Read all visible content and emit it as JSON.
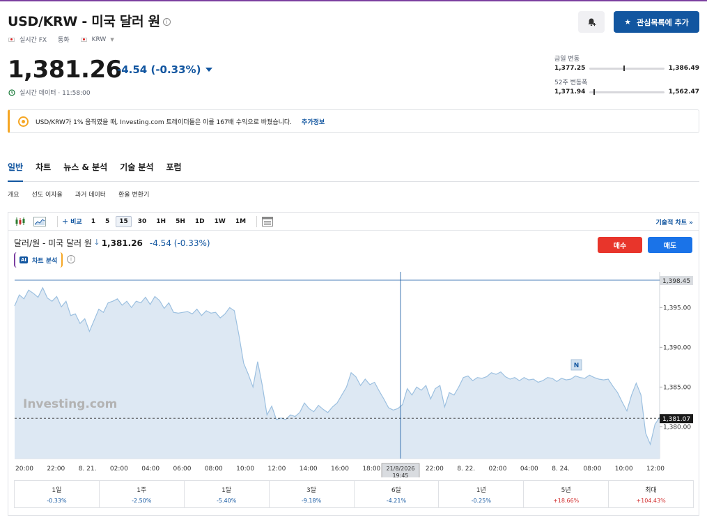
{
  "header": {
    "title": "USD/KRW - 미국 달러 원",
    "info_icon": "info-icon",
    "sub_items": [
      "실시간 FX",
      "통화",
      "KRW"
    ],
    "alert_icon": "bell-plus-icon",
    "watchlist_label": "관심목록에 추가",
    "watchlist_icon": "star-icon"
  },
  "quote": {
    "price": "1,381.26",
    "change": "-4.54 (-0.33%)",
    "time_text": "실시간 데이터 · 11:58:00",
    "down_color": "#1256a0"
  },
  "ranges": {
    "day": {
      "label": "금일 변동",
      "low": "1,377.25",
      "high": "1,386.49",
      "position": 0.45
    },
    "week52": {
      "label": "52주 변동폭",
      "low": "1,371.94",
      "high": "1,562.47",
      "position": 0.05
    }
  },
  "banner": {
    "text": "USD/KRW가 1% 움직였을 때, Investing.com 트레이더들은 이를 167배 수익으로 바꿨습니다.",
    "link": "추가정보",
    "accent": "#f5a623"
  },
  "tabs": [
    "일반",
    "차트",
    "뉴스 & 분석",
    "기술 분석",
    "포럼"
  ],
  "subtabs": [
    "개요",
    "선도 이자율",
    "과거 데이터",
    "환율 변환기"
  ],
  "toolbar": {
    "compare": "비교",
    "intervals": [
      "1",
      "5",
      "15",
      "30",
      "1H",
      "5H",
      "1D",
      "1W",
      "1M"
    ],
    "selected_interval": "15",
    "tech_chart": "기술적 차트 »"
  },
  "chart_header": {
    "name": "달러/원 - 미국 달러 원",
    "price": "1,381.26",
    "change": "-4.54 (-0.33%)",
    "ai_badge": "AI",
    "ai_label": "차트 분석",
    "buy": "매수",
    "sell": "매도",
    "buy_color": "#e8352b",
    "sell_color": "#1a73e8"
  },
  "chart_data": {
    "type": "area",
    "watermark": "Investing.com",
    "y_ticks": [
      1380,
      1385,
      1390,
      1395
    ],
    "y_tick_labels": [
      "1,380.00",
      "1,385.00",
      "1,390.00",
      "1,395.00"
    ],
    "ylim": [
      1376,
      1399.5
    ],
    "x_tick_labels": [
      "20:00",
      "22:00",
      "8. 21.",
      "02:00",
      "04:00",
      "06:00",
      "08:00",
      "10:00",
      "12:00",
      "14:00",
      "16:00",
      "18:00",
      "20:00",
      "22:00",
      "8. 22.",
      "02:00",
      "04:00",
      "8. 24.",
      "08:00",
      "10:00",
      "12:00"
    ],
    "high_line": {
      "value": 1398.45,
      "label": "1,398.45"
    },
    "last_line": {
      "value": 1381.07,
      "label": "1,381.07"
    },
    "crosshair": {
      "label_date": "21/8/2026",
      "label_time": "19:45"
    },
    "news_marker": "N",
    "values": [
      1395.2,
      1396.6,
      1396.1,
      1397.2,
      1396.8,
      1396.3,
      1397.5,
      1396.2,
      1395.8,
      1396.4,
      1395.1,
      1395.8,
      1394.0,
      1394.2,
      1393.0,
      1393.6,
      1392.0,
      1393.4,
      1394.8,
      1394.4,
      1395.6,
      1395.8,
      1396.1,
      1395.3,
      1395.8,
      1395.0,
      1395.8,
      1395.6,
      1396.3,
      1395.4,
      1396.4,
      1395.9,
      1394.9,
      1395.6,
      1394.4,
      1394.3,
      1394.4,
      1394.5,
      1394.2,
      1394.8,
      1394.0,
      1394.6,
      1394.3,
      1394.4,
      1393.7,
      1394.2,
      1395.0,
      1394.6,
      1391.5,
      1388.0,
      1386.6,
      1385.0,
      1388.2,
      1385.2,
      1381.5,
      1382.6,
      1380.9,
      1381.1,
      1380.9,
      1381.5,
      1381.3,
      1381.8,
      1383.0,
      1382.3,
      1381.9,
      1382.7,
      1382.2,
      1381.8,
      1382.5,
      1383.0,
      1384.0,
      1385.0,
      1386.8,
      1386.3,
      1385.2,
      1386.0,
      1385.3,
      1385.6,
      1384.5,
      1383.5,
      1382.4,
      1382.1,
      1382.3,
      1382.8,
      1384.8,
      1384.0,
      1385.0,
      1384.6,
      1385.2,
      1383.5,
      1384.8,
      1385.2,
      1382.5,
      1384.3,
      1384.0,
      1385.0,
      1386.2,
      1386.4,
      1385.8,
      1386.2,
      1386.1,
      1386.3,
      1386.8,
      1386.6,
      1386.9,
      1386.3,
      1386.0,
      1386.2,
      1385.8,
      1386.2,
      1385.9,
      1386.0,
      1385.6,
      1385.8,
      1386.2,
      1386.1,
      1385.7,
      1386.1,
      1385.9,
      1386.0,
      1386.4,
      1386.2,
      1386.1,
      1386.5,
      1386.2,
      1386.0,
      1385.9,
      1386.0,
      1385.1,
      1384.3,
      1383.1,
      1382.0,
      1384.0,
      1385.5,
      1384.0,
      1379.2,
      1377.8,
      1380.3,
      1381.2
    ]
  },
  "performance": [
    {
      "label": "1일",
      "value": "-0.33%",
      "sign": "neg"
    },
    {
      "label": "1주",
      "value": "-2.50%",
      "sign": "neg"
    },
    {
      "label": "1달",
      "value": "-5.40%",
      "sign": "neg"
    },
    {
      "label": "3달",
      "value": "-9.18%",
      "sign": "neg"
    },
    {
      "label": "6달",
      "value": "-4.21%",
      "sign": "neg"
    },
    {
      "label": "1년",
      "value": "-0.25%",
      "sign": "neg"
    },
    {
      "label": "5년",
      "value": "+18.66%",
      "sign": "pos"
    },
    {
      "label": "최대",
      "value": "+104.43%",
      "sign": "pos"
    }
  ]
}
